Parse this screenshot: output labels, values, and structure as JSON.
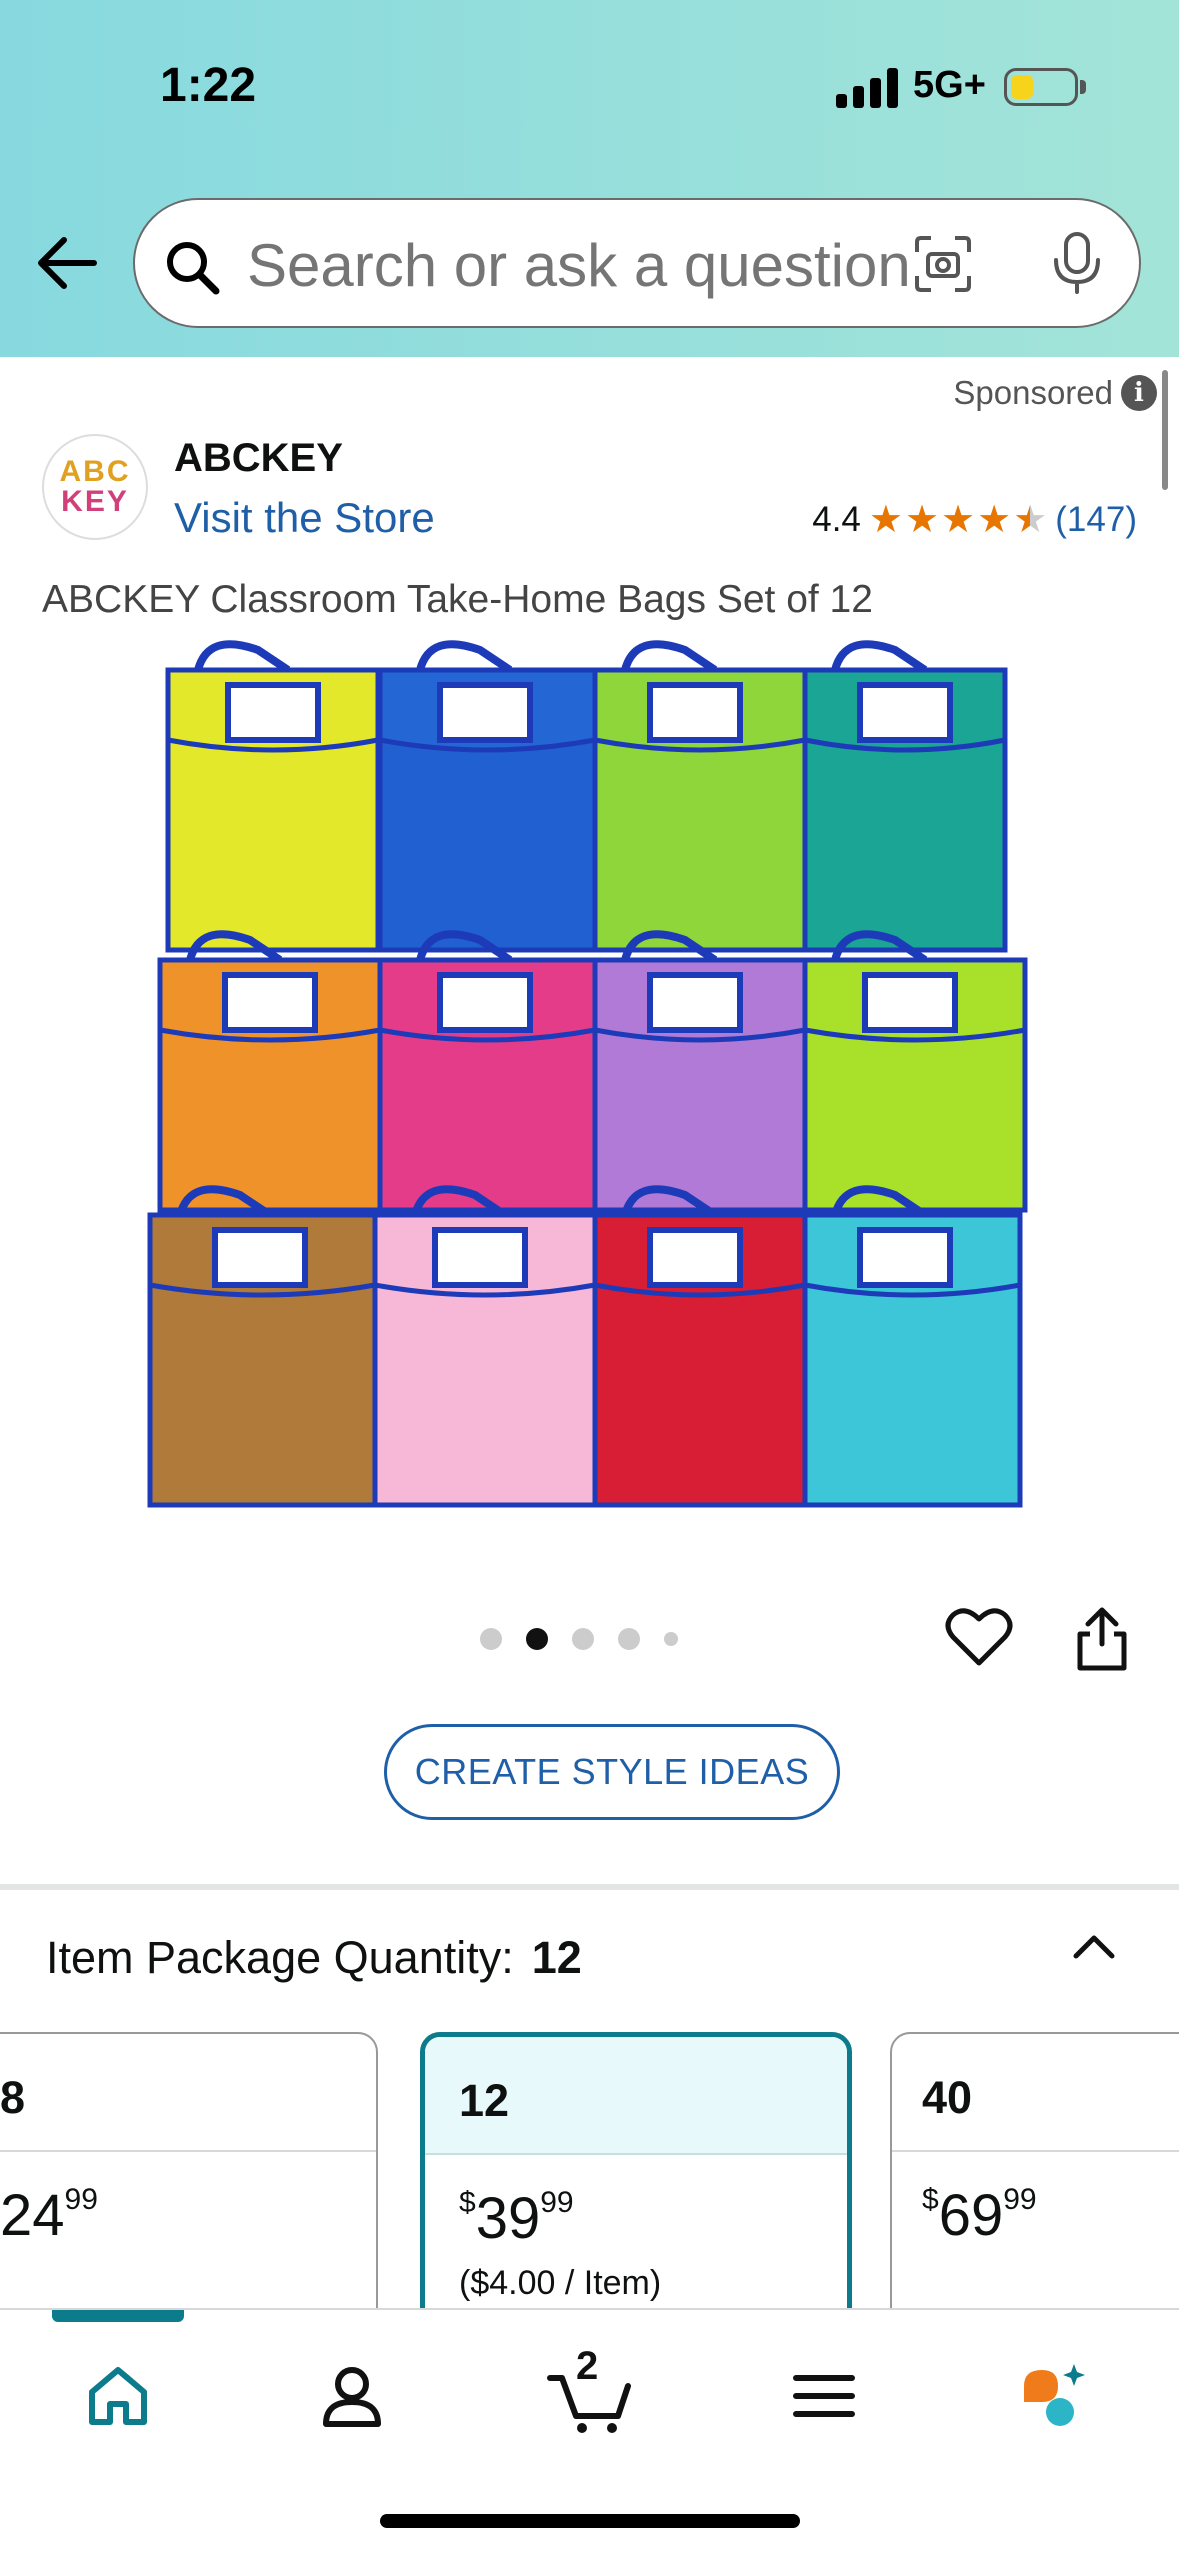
{
  "status_bar": {
    "time": "1:22",
    "network": "5G+"
  },
  "search": {
    "placeholder": "Search or ask a question"
  },
  "ad": {
    "sponsored_label": "Sponsored"
  },
  "brand": {
    "logo_line1": "ABC",
    "logo_line2": "KEY",
    "name": "ABCKEY",
    "visit_store": "Visit the Store"
  },
  "rating": {
    "value": "4.4",
    "stars": 4.4,
    "count": "(147)"
  },
  "product": {
    "title": "ABCKEY Classroom Take-Home Bags Set of 12"
  },
  "gallery": {
    "image_count": 5,
    "active_index": 1
  },
  "actions": {
    "create_style_ideas": "CREATE STYLE IDEAS"
  },
  "package": {
    "label": "Item Package Quantity:",
    "selected_value": "12",
    "options": [
      {
        "qty": "8",
        "price_whole": "24",
        "price_fraction": "99",
        "per_item": "",
        "selected": false
      },
      {
        "qty": "12",
        "price_symbol": "$",
        "price_whole": "39",
        "price_fraction": "99",
        "per_item": "($4.00 / Item)",
        "selected": true
      },
      {
        "qty": "40",
        "price_symbol": "$",
        "price_whole": "69",
        "price_fraction": "99",
        "per_item": "",
        "selected": false
      }
    ]
  },
  "tabbar": {
    "cart_count": "2",
    "active_tab": "home"
  },
  "colors": {
    "accent_teal": "#0c7b8c",
    "link_blue": "#1f5fa8",
    "star_orange": "#e77600"
  }
}
